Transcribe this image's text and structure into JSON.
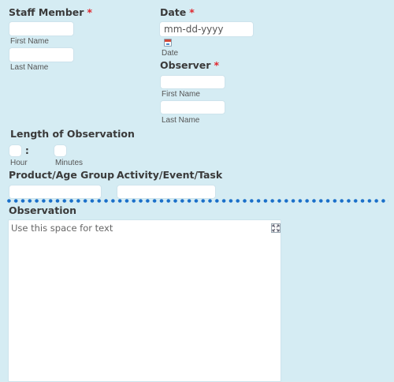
{
  "staff_member": {
    "label": "Staff Member",
    "required_mark": "*",
    "first_name_label": "First Name",
    "last_name_label": "Last Name",
    "first_name_value": "",
    "last_name_value": ""
  },
  "date": {
    "label": "Date",
    "required_mark": "*",
    "placeholder": "mm-dd-yyyy",
    "sublabel": "Date"
  },
  "observer": {
    "label": "Observer",
    "required_mark": "*",
    "first_name_label": "First Name",
    "last_name_label": "Last Name"
  },
  "length_of_observation": {
    "label": "Length of Observation",
    "separator": ":",
    "hour_label": "Hour",
    "minutes_label": "Minutes"
  },
  "product_age_group": {
    "label": "Product/Age Group"
  },
  "activity_event_task": {
    "label": "Activity/Event/Task"
  },
  "observation": {
    "label": "Observation",
    "placeholder": "Use this space for text"
  },
  "colors": {
    "background": "#d5ecf3",
    "required": "#e0282f",
    "divider": "#1a6fc9"
  },
  "icons": [
    "calendar-icon",
    "expand-icon"
  ]
}
